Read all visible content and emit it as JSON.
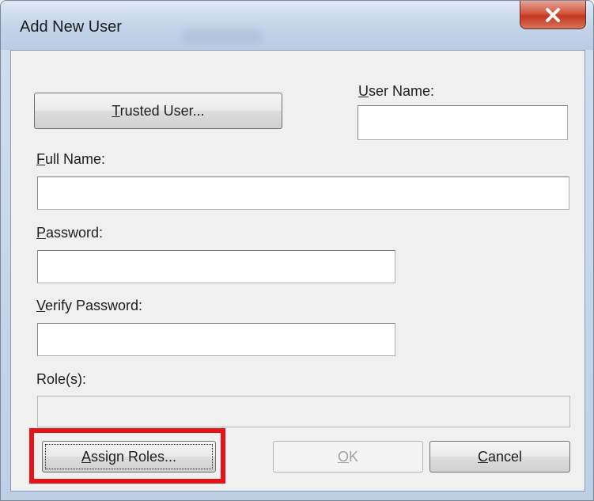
{
  "window": {
    "title": "Add New User",
    "close_icon": "close-icon"
  },
  "form": {
    "trusted_user_button": "Trusted User...",
    "user_name_label": "User Name:",
    "user_name_value": "",
    "full_name_label": "Full Name:",
    "full_name_value": "",
    "password_label": "Password:",
    "password_value": "",
    "verify_password_label": "Verify Password:",
    "verify_password_value": "",
    "roles_label": "Role(s):",
    "roles_value": ""
  },
  "buttons": {
    "assign_roles": "Assign Roles...",
    "ok": "OK",
    "cancel": "Cancel"
  },
  "colors": {
    "highlight": "#e8121a",
    "close_button": "#c2381f"
  }
}
